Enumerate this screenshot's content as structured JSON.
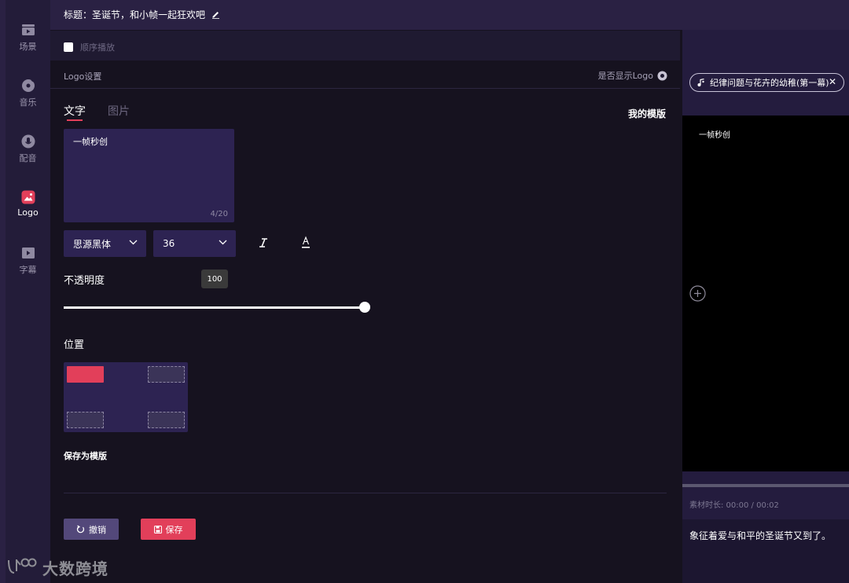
{
  "header": {
    "title": "标题：圣诞节，和小帧一起狂欢吧"
  },
  "sidebar": {
    "items": [
      {
        "label": "场景",
        "icon": "scene-icon"
      },
      {
        "label": "音乐",
        "icon": "music-icon"
      },
      {
        "label": "配音",
        "icon": "microphone-icon"
      },
      {
        "label": "Logo",
        "icon": "image-icon",
        "active": true
      },
      {
        "label": "字幕",
        "icon": "subtitle-icon"
      }
    ]
  },
  "toolbar": {
    "sequential_play_label": "顺序播放",
    "sequential_play_checked": false
  },
  "logo_panel": {
    "heading": "Logo设置",
    "show_logo_label": "是否显示Logo",
    "tabs": [
      {
        "label": "文字",
        "active": true
      },
      {
        "label": "图片",
        "active": false
      }
    ],
    "my_templates_label": "我的模版",
    "text_value": "一帧秒创",
    "char_count": "4/20",
    "font_family": "思源黑体",
    "font_size": "36",
    "opacity_label": "不透明度",
    "opacity_value": "100",
    "opacity_fraction": 1.0,
    "position_label": "位置",
    "position_selected": "top-left",
    "save_as_template_label": "保存为模版",
    "undo_label": "撤销",
    "save_label": "保存"
  },
  "watermark": {
    "text": "大数跨境"
  },
  "preview": {
    "track_chip": "纪律问题与花卉的幼稚(第一幕)",
    "logo_text": "一帧秒创",
    "duration_text": "素材时长: 00:00 / 00:02",
    "subtitle_text": "象征着爱与和平的圣诞节又到了。"
  },
  "colors": {
    "accent": "#e23f5a",
    "panel": "#2d2352",
    "background": "#16121f"
  }
}
